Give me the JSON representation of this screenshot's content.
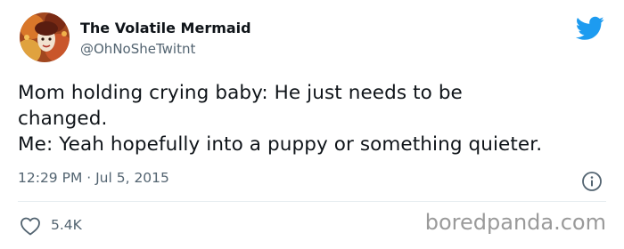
{
  "author": {
    "display_name": "The Volatile Mermaid",
    "handle": "@OhNoSheTwitnt",
    "avatar_icon": "profile-photo"
  },
  "tweet": {
    "lines": [
      "Mom holding crying baby: He just needs to be",
      "changed.",
      "Me: Yeah hopefully into a puppy or something quieter."
    ],
    "timestamp": "12:29 PM · Jul 5, 2015",
    "likes": "5.4K"
  },
  "icons": {
    "brand": "twitter-bird-icon",
    "info": "info-icon",
    "like": "heart-icon"
  },
  "colors": {
    "twitter_blue": "#1d9bf0",
    "secondary_text": "#536471",
    "watermark": "#9a9a9a"
  },
  "watermark": "boredpanda.com"
}
